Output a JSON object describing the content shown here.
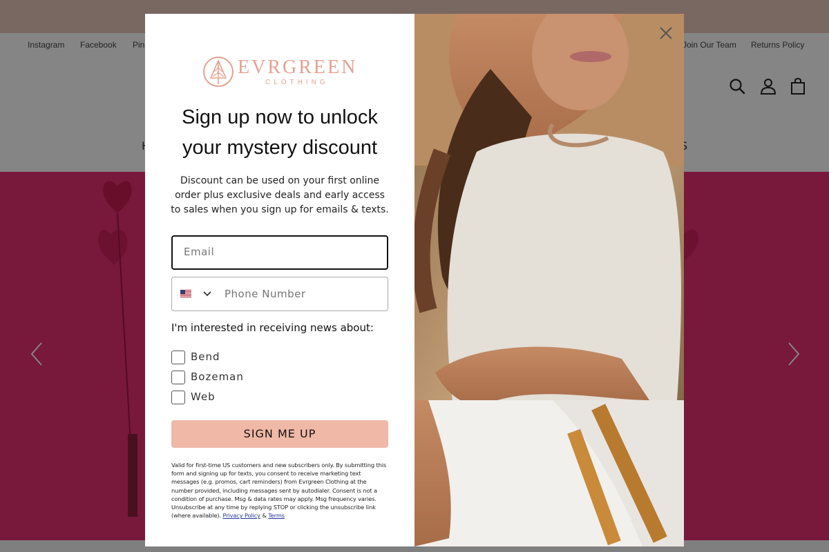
{
  "announcement": {
    "text": ""
  },
  "top_links": {
    "instagram": "Instagram",
    "facebook": "Facebook",
    "pinterest": "Pin",
    "join": "Join Our Team",
    "returns": "Returns Policy"
  },
  "header_icons": [
    "search-icon",
    "account-icon",
    "cart-icon"
  ],
  "main_nav": {
    "left": "H",
    "right": "S"
  },
  "hero": {
    "background_color": "#e62f71"
  },
  "popup": {
    "logo_text": "EVRGREEN",
    "logo_sub": "CLOTHING",
    "headline_line1": "Sign up now to unlock",
    "headline_line2": "your mystery discount",
    "subtext": "Discount can be used on your first online order plus exclusive deals and early access to sales when you sign up for emails & texts.",
    "email_placeholder": "Email",
    "phone_placeholder": "Phone Number",
    "interest_label": "I'm interested in receiving news about:",
    "options": [
      {
        "label": "Bend",
        "checked": false
      },
      {
        "label": "Bozeman",
        "checked": false
      },
      {
        "label": "Web",
        "checked": false
      }
    ],
    "submit_label": "SIGN ME UP",
    "submit_color": "#f0b8a7",
    "legal_text": "Valid for first-time US customers and new subscribers only. By submitting this form and signing up for texts, you consent to receive marketing text messages (e.g. promos, cart reminders) from Evrgreen Clothing at the number provided, including messages sent by autodialer. Consent is not a condition of purchase. Msg & data rates may apply. Msg frequency varies. Unsubscribe at any time by replying STOP or clicking the unsubscribe link (where available).",
    "privacy_label": "Privacy Policy",
    "amp": "&",
    "terms_label": "Terms",
    "brand_color": "#e6a090"
  }
}
